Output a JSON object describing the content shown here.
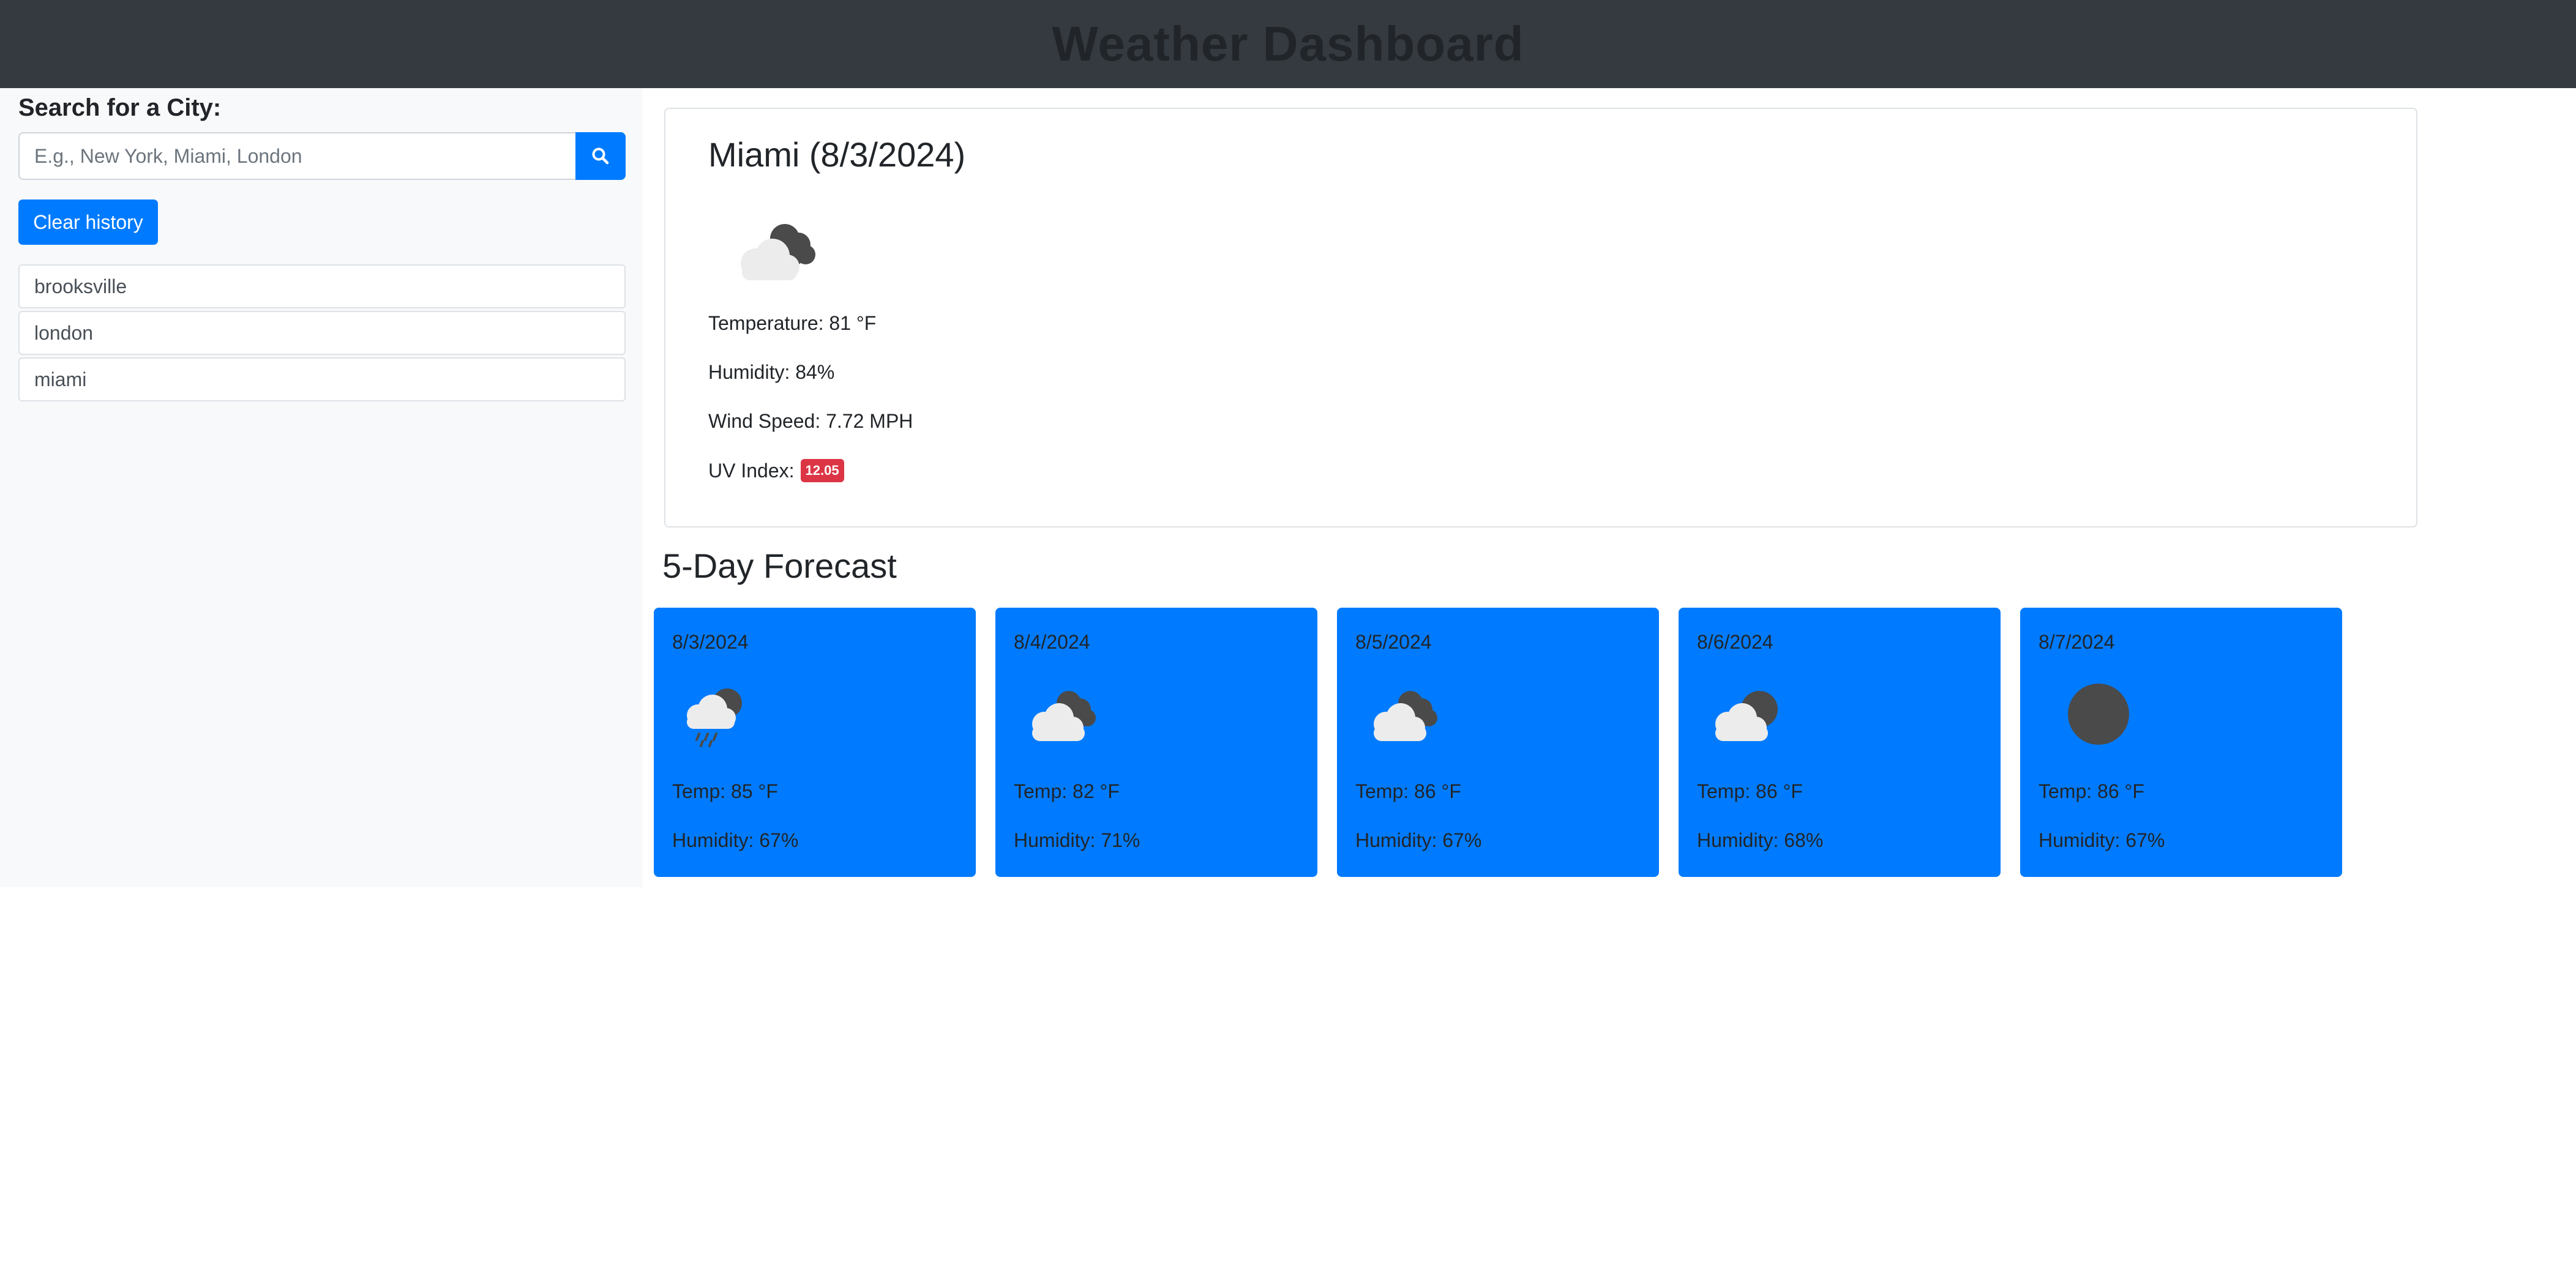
{
  "header": {
    "title": "Weather Dashboard"
  },
  "sidebar": {
    "search_heading": "Search for a City:",
    "search_placeholder": "E.g., New York, Miami, London",
    "search_icon": "search-icon",
    "clear_label": "Clear history",
    "history": [
      "brooksville",
      "london",
      "miami"
    ]
  },
  "current": {
    "title": "Miami (8/3/2024)",
    "icon": "cloudy-icon",
    "temperature": "Temperature: 81 °F",
    "humidity": "Humidity: 84%",
    "wind": "Wind Speed: 7.72 MPH",
    "uv_label": "UV Index:",
    "uv_value": "12.05",
    "uv_color": "#dc3545"
  },
  "forecast": {
    "title": "5-Day Forecast",
    "card_color": "#007bff",
    "days": [
      {
        "date": "8/3/2024",
        "icon": "rain-icon",
        "temp": "Temp: 85 °F",
        "humidity": "Humidity: 67%"
      },
      {
        "date": "8/4/2024",
        "icon": "cloudy-icon",
        "temp": "Temp: 82 °F",
        "humidity": "Humidity: 71%"
      },
      {
        "date": "8/5/2024",
        "icon": "cloudy-icon",
        "temp": "Temp: 86 °F",
        "humidity": "Humidity: 67%"
      },
      {
        "date": "8/6/2024",
        "icon": "partly-cloudy-icon",
        "temp": "Temp: 86 °F",
        "humidity": "Humidity: 68%"
      },
      {
        "date": "8/7/2024",
        "icon": "clear-sky-icon",
        "temp": "Temp: 86 °F",
        "humidity": "Humidity: 67%"
      }
    ]
  }
}
